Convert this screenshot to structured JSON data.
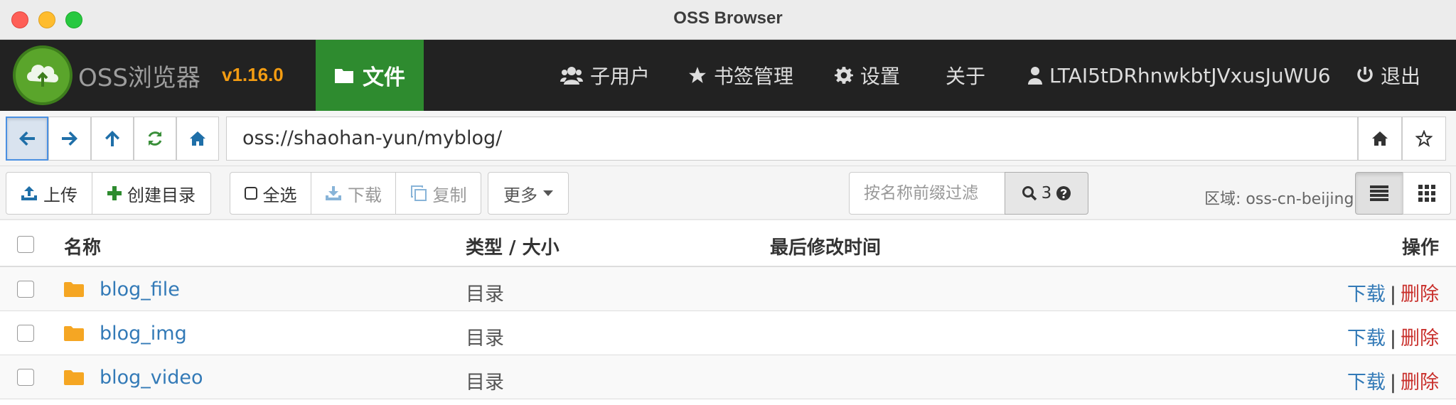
{
  "window": {
    "title": "OSS Browser"
  },
  "navbar": {
    "brand": "OSS浏览器",
    "version": "v1.16.0",
    "files_label": "文件",
    "items": [
      {
        "label": "子用户",
        "icon": "users-icon"
      },
      {
        "label": "书签管理",
        "icon": "star-icon"
      },
      {
        "label": "设置",
        "icon": "gear-icon"
      },
      {
        "label": "关于",
        "icon": ""
      },
      {
        "label": "LTAI5tDRhnwkbtJVxusJuWU6",
        "icon": "user-icon"
      },
      {
        "label": "退出",
        "icon": "power-icon"
      }
    ]
  },
  "pathbar": {
    "address": "oss://shaohan-yun/myblog/"
  },
  "actions": {
    "upload": "上传",
    "mkdir": "创建目录",
    "select_all": "全选",
    "download": "下载",
    "copy": "复制",
    "more": "更多",
    "filter_placeholder": "按名称前缀过滤",
    "search_count": "3",
    "region": "区域: oss-cn-beijing"
  },
  "table": {
    "headers": {
      "name": "名称",
      "type_size": "类型 / 大小",
      "modified": "最后修改时间",
      "ops": "操作"
    },
    "rows": [
      {
        "name": "blog_file",
        "type": "目录",
        "op_download": "下载",
        "op_sep": "|",
        "op_delete": "删除"
      },
      {
        "name": "blog_img",
        "type": "目录",
        "op_download": "下载",
        "op_sep": "|",
        "op_delete": "删除"
      },
      {
        "name": "blog_video",
        "type": "目录",
        "op_download": "下载",
        "op_sep": "|",
        "op_delete": "删除"
      }
    ]
  },
  "colors": {
    "navbar_bg": "#222222",
    "files_tab": "#2e8b2f",
    "version": "#f39c12",
    "link": "#337ab7",
    "delete": "#c9302c",
    "folder": "#f5a623"
  }
}
